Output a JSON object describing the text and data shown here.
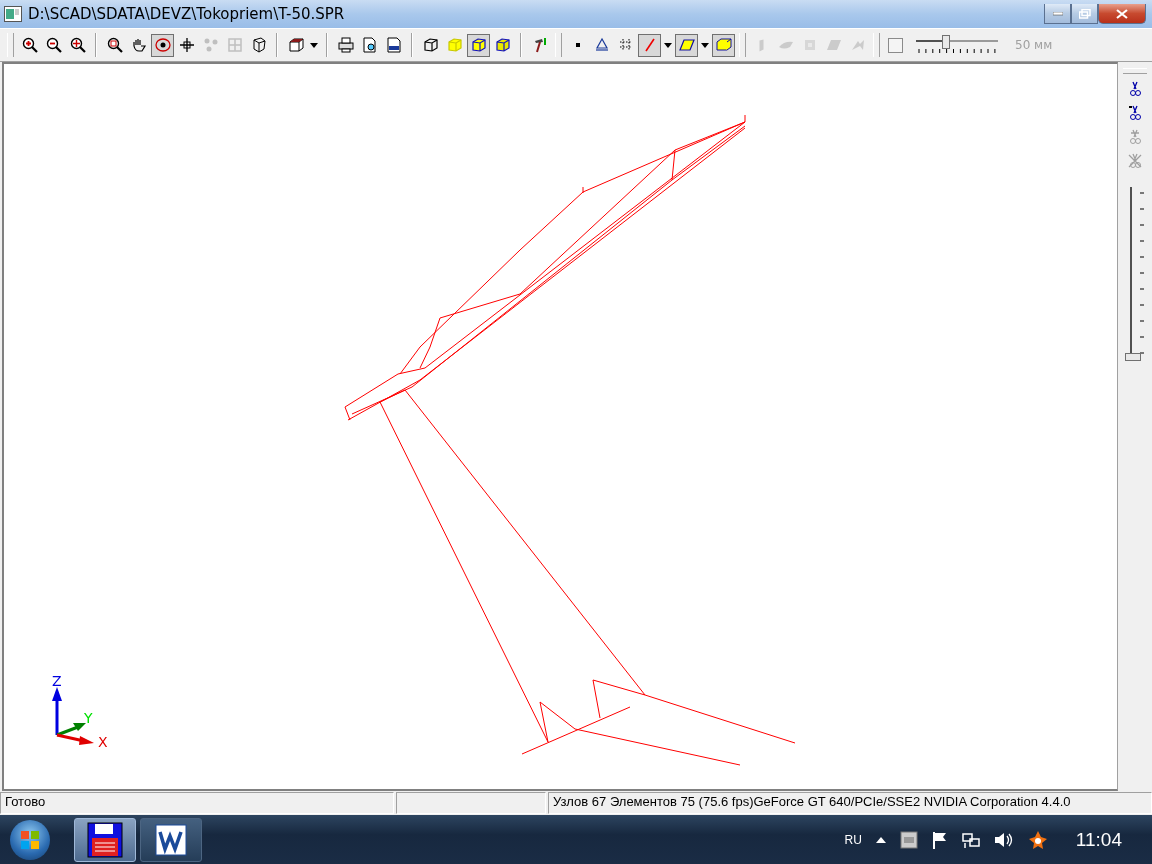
{
  "window": {
    "title": "D:\\SCAD\\SDATA\\DEVZ\\Tokopriem\\T-50.SPR"
  },
  "toolbar": {
    "groups": [
      {
        "buttons": [
          {
            "pressed": false,
            "disabled": false,
            "dropdown": false
          },
          {
            "pressed": false,
            "disabled": false,
            "dropdown": false
          },
          {
            "pressed": false,
            "disabled": false,
            "dropdown": false
          }
        ]
      },
      {
        "buttons": [
          {
            "pressed": false,
            "disabled": false,
            "dropdown": false
          },
          {
            "pressed": false,
            "disabled": false,
            "dropdown": false
          },
          {
            "pressed": true,
            "disabled": false,
            "dropdown": false
          },
          {
            "pressed": false,
            "disabled": false,
            "dropdown": false
          },
          {
            "pressed": false,
            "disabled": true,
            "dropdown": false
          },
          {
            "pressed": false,
            "disabled": true,
            "dropdown": false
          },
          {
            "pressed": false,
            "disabled": false,
            "dropdown": false
          }
        ]
      },
      {
        "buttons": [
          {
            "pressed": false,
            "disabled": false,
            "dropdown": true
          }
        ]
      },
      {
        "buttons": [
          {
            "pressed": false,
            "disabled": false,
            "dropdown": false
          },
          {
            "pressed": false,
            "disabled": false,
            "dropdown": false
          },
          {
            "pressed": false,
            "disabled": false,
            "dropdown": false
          }
        ]
      },
      {
        "buttons": [
          {
            "pressed": false,
            "disabled": false,
            "dropdown": false
          },
          {
            "pressed": false,
            "disabled": false,
            "dropdown": false
          },
          {
            "pressed": true,
            "disabled": false,
            "dropdown": false
          },
          {
            "pressed": false,
            "disabled": false,
            "dropdown": false
          }
        ]
      },
      {
        "buttons": [
          {
            "pressed": false,
            "disabled": false,
            "dropdown": false
          }
        ]
      },
      {
        "buttons": [
          {
            "pressed": false,
            "disabled": false,
            "dropdown": false
          },
          {
            "pressed": false,
            "disabled": false,
            "dropdown": false
          },
          {
            "pressed": false,
            "disabled": false,
            "dropdown": false
          },
          {
            "pressed": true,
            "disabled": false,
            "dropdown": true
          },
          {
            "pressed": true,
            "disabled": false,
            "dropdown": true
          },
          {
            "pressed": true,
            "disabled": false,
            "dropdown": false
          }
        ]
      },
      {
        "buttons": [
          {
            "pressed": false,
            "disabled": true,
            "dropdown": false
          },
          {
            "pressed": false,
            "disabled": true,
            "dropdown": false
          },
          {
            "pressed": false,
            "disabled": true,
            "dropdown": false
          },
          {
            "pressed": false,
            "disabled": true,
            "dropdown": false
          },
          {
            "pressed": false,
            "disabled": true,
            "dropdown": false
          }
        ]
      }
    ],
    "scale": {
      "checked": false,
      "level": 0.35,
      "reading": "50 мм"
    }
  },
  "side_toolbar": {
    "buttons": [
      {
        "disabled": false
      },
      {
        "disabled": false
      },
      {
        "disabled": true
      },
      {
        "disabled": true
      }
    ],
    "slider": {
      "level": 1
    }
  },
  "axes": {
    "z": "Z",
    "y": "Y",
    "x": "X"
  },
  "status_bar": {
    "panes": [
      "Готово",
      "Узлов 67  Элементов 75  (75.6 fps)GeForce GT 640/PCIe/SSE2 NVIDIA Corporation 4.4.0"
    ]
  },
  "taskbar": {
    "apps": [
      {
        "selected": true
      },
      {
        "selected": false
      }
    ],
    "language": "RU",
    "clock": "11:04"
  }
}
